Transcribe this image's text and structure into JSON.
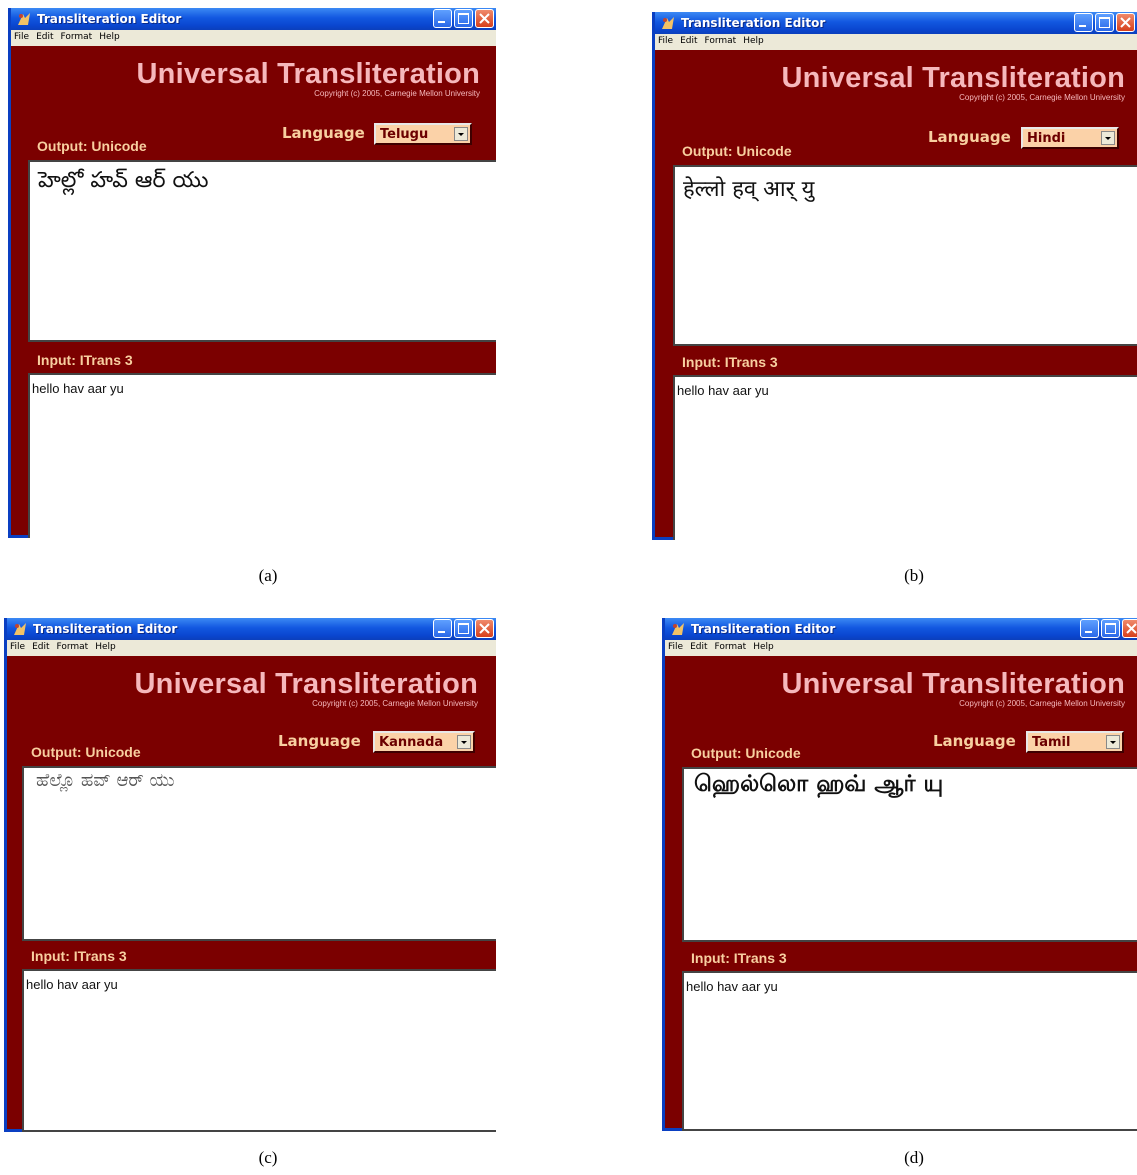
{
  "panels": [
    {
      "window_title": "Transliteration Editor",
      "menu": [
        "File",
        "Edit",
        "Format",
        "Help"
      ],
      "brand_title": "Universal Transliteration",
      "copyright": "Copyright (c) 2005, Carnegie Mellon University",
      "language_label": "Language",
      "language_value": "Telugu",
      "output_label": "Output: Unicode",
      "output_text": "హెల్లో హవ్ ఆర్ యు",
      "input_label": "Input: ITrans 3",
      "input_text": "hello hav aar yu",
      "caption": "(a)"
    },
    {
      "window_title": "Transliteration Editor",
      "menu": [
        "File",
        "Edit",
        "Format",
        "Help"
      ],
      "brand_title": "Universal Transliteration",
      "copyright": "Copyright (c) 2005, Carnegie Mellon University",
      "language_label": "Language",
      "language_value": "Hindi",
      "output_label": "Output: Unicode",
      "output_text": "हेल्लो हव् आर् यु",
      "input_label": "Input: ITrans 3",
      "input_text": "hello hav aar yu",
      "caption": "(b)"
    },
    {
      "window_title": "Transliteration Editor",
      "menu": [
        "File",
        "Edit",
        "Format",
        "Help"
      ],
      "brand_title": "Universal Transliteration",
      "copyright": "Copyright (c) 2005, Carnegie Mellon University",
      "language_label": "Language",
      "language_value": "Kannada",
      "output_label": "Output: Unicode",
      "output_text": "ಹೆಲ್ಲೊ ಹವ್ ಆರ್ ಯು",
      "input_label": "Input: ITrans 3",
      "input_text": "hello hav aar yu",
      "caption": "(c)"
    },
    {
      "window_title": "Transliteration Editor",
      "menu": [
        "File",
        "Edit",
        "Format",
        "Help"
      ],
      "brand_title": "Universal Transliteration",
      "copyright": "Copyright (c) 2005, Carnegie Mellon University",
      "language_label": "Language",
      "language_value": "Tamil",
      "output_label": "Output: Unicode",
      "output_text": "ஹெல்லொ ஹவ் ஆர் யு",
      "input_label": "Input: ITrans 3",
      "input_text": "hello hav aar yu",
      "caption": "(d)"
    }
  ],
  "colors": {
    "client_background": "#7b0000",
    "brand_text": "#f6b8bc",
    "label_text": "#f8cfa0",
    "select_background": "#fbd2a8",
    "titlebar_blue": "#1257e0"
  },
  "icons": {
    "app": "app-icon",
    "minimize": "minimize-icon",
    "maximize": "maximize-icon",
    "close": "close-icon",
    "dropdown": "chevron-down-icon"
  }
}
